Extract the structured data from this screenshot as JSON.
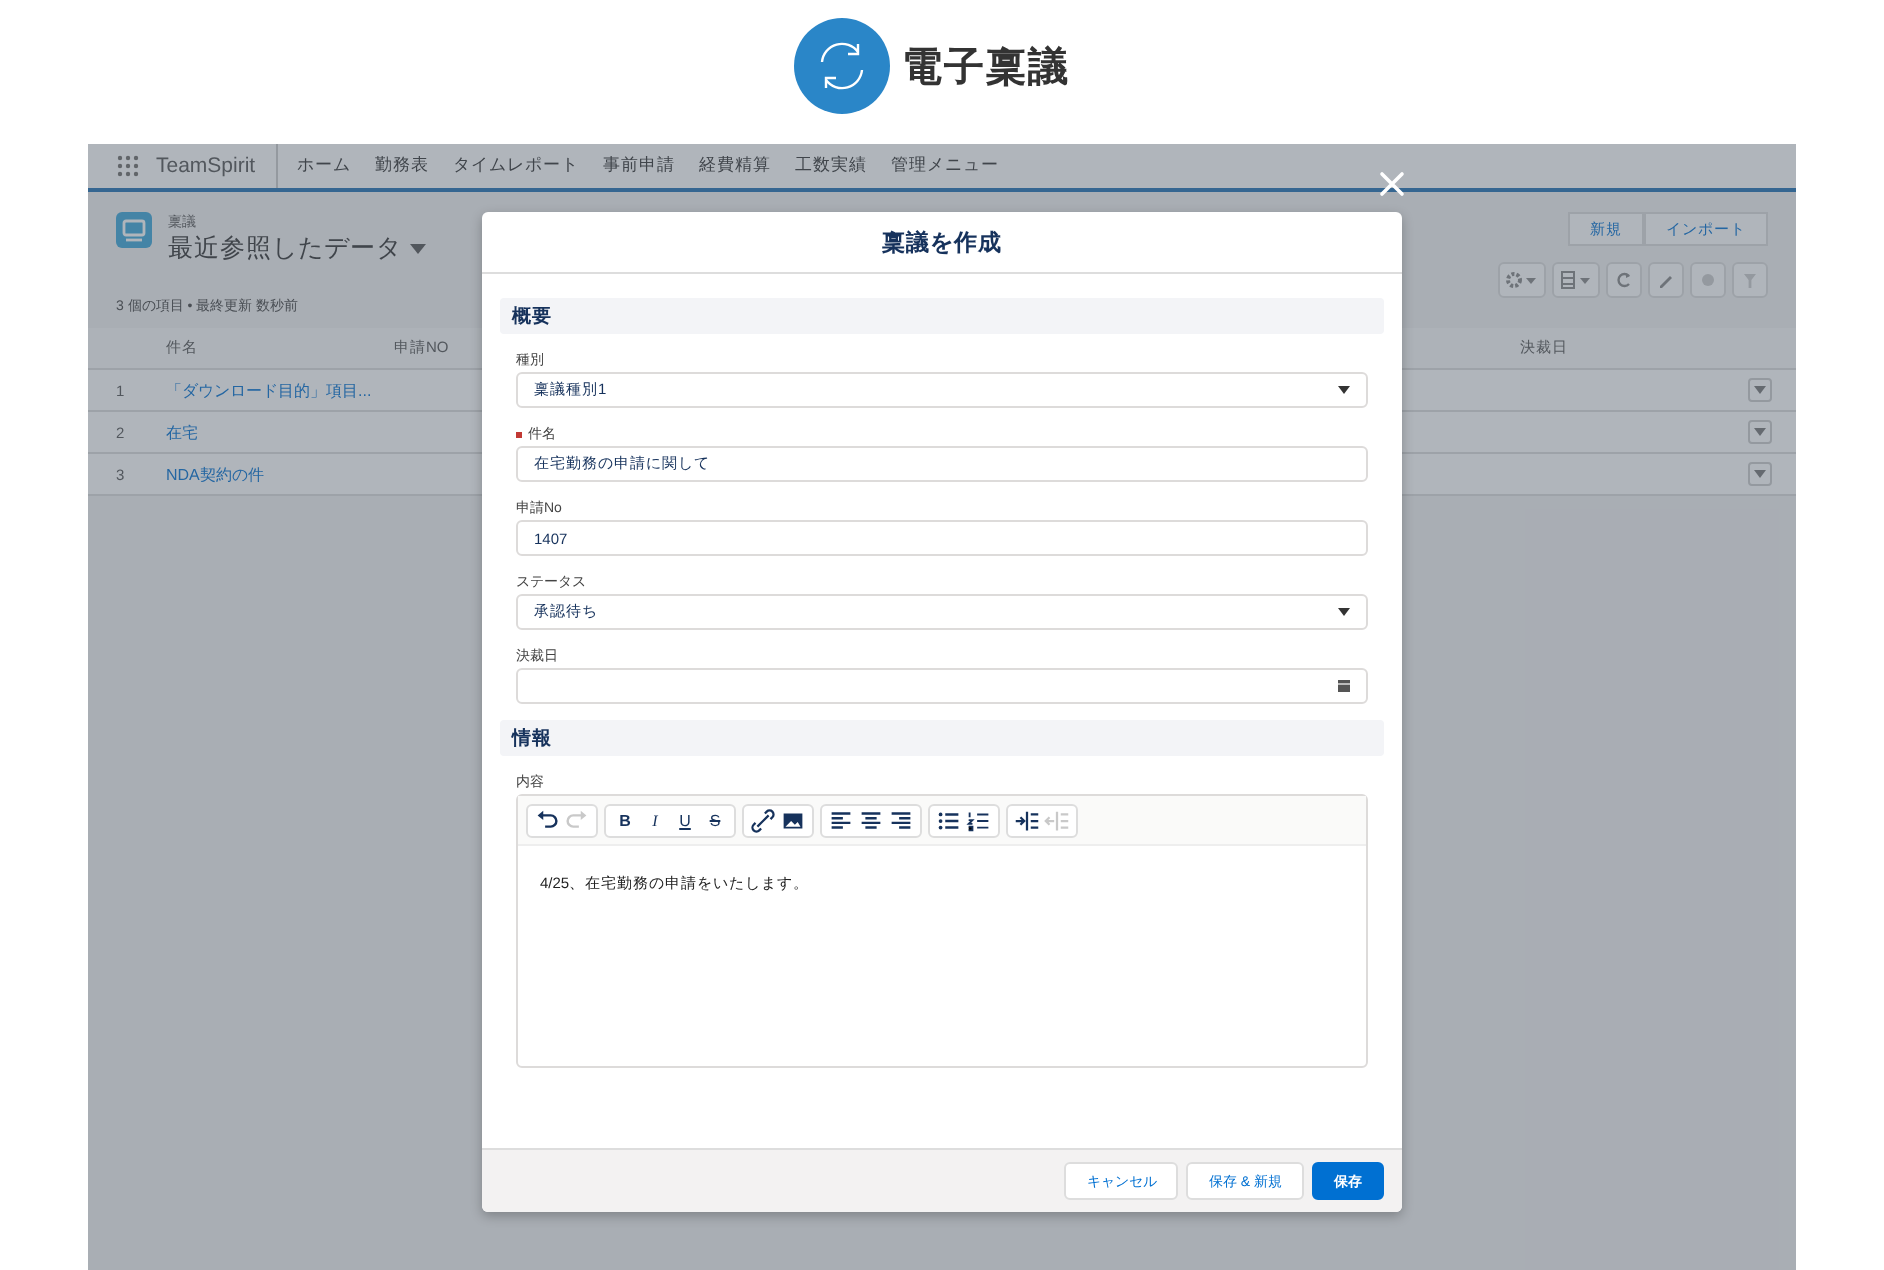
{
  "logo": {
    "title": "電子稟議"
  },
  "navbar": {
    "app_name": "TeamSpirit",
    "items": [
      "ホーム",
      "勤務表",
      "タイムレポート",
      "事前申請",
      "経費精算",
      "工数実績",
      "管理メニュー"
    ]
  },
  "list": {
    "object": "稟議",
    "title": "最近参照したデータ",
    "buttons": [
      "新規",
      "インポート"
    ],
    "summary": "3 個の項目 • 最終更新 数秒前",
    "columns": [
      "件名",
      "申請NO",
      "決裁日"
    ],
    "rows": [
      {
        "number": "1",
        "subject": "「ダウンロード目的」項目..."
      },
      {
        "number": "2",
        "subject": "在宅"
      },
      {
        "number": "3",
        "subject": "NDA契約の件"
      }
    ]
  },
  "modal": {
    "title": "稟議を作成",
    "sections": [
      {
        "heading": "概要",
        "fields": [
          {
            "kind": "select",
            "label": "種別",
            "value": "稟議種別1",
            "required": false
          },
          {
            "kind": "text",
            "label": "件名",
            "value": "在宅勤務の申請に関して",
            "required": true
          },
          {
            "kind": "text",
            "label": "申請No",
            "value": "1407",
            "required": false
          },
          {
            "kind": "select",
            "label": "ステータス",
            "value": "承認待ち",
            "required": false
          },
          {
            "kind": "date",
            "label": "決裁日",
            "required": false
          }
        ]
      },
      {
        "heading": "情報",
        "fields": [
          {
            "kind": "richtext",
            "label": "内容",
            "value": "4/25、在宅勤務の申請をいたします。",
            "required": false,
            "toolbar": [
              [
                {
                  "kind": "undo",
                  "disabled": false
                },
                {
                  "kind": "redo",
                  "disabled": true
                }
              ],
              [
                {
                  "kind": "bold",
                  "label": "B",
                  "disabled": false
                },
                {
                  "kind": "italic",
                  "label": "I",
                  "disabled": false
                },
                {
                  "kind": "underline",
                  "label": "U",
                  "disabled": false
                },
                {
                  "kind": "strike",
                  "label": "S",
                  "disabled": false
                }
              ],
              [
                {
                  "kind": "link",
                  "disabled": false
                },
                {
                  "kind": "image",
                  "disabled": false
                }
              ],
              [
                {
                  "kind": "align-left",
                  "disabled": false
                },
                {
                  "kind": "align-center",
                  "disabled": false
                },
                {
                  "kind": "align-right",
                  "disabled": false
                }
              ],
              [
                {
                  "kind": "bullets",
                  "disabled": false
                },
                {
                  "kind": "numbers",
                  "disabled": false
                }
              ],
              [
                {
                  "kind": "indent",
                  "disabled": false
                },
                {
                  "kind": "outdent",
                  "disabled": true
                }
              ]
            ]
          }
        ]
      }
    ],
    "buttons": [
      {
        "label": "キャンセル",
        "primary": false
      },
      {
        "label": "保存 & 新規",
        "primary": false
      },
      {
        "label": "保存",
        "primary": true
      }
    ]
  }
}
